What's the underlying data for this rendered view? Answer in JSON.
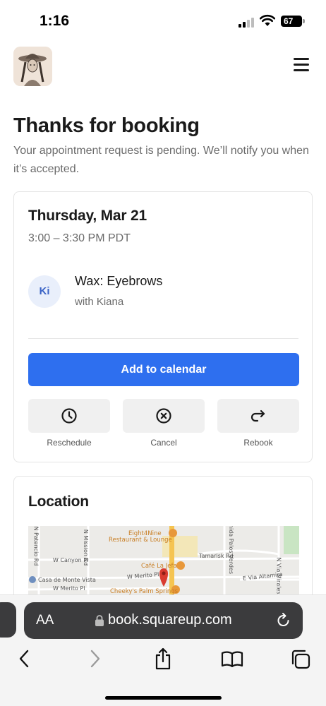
{
  "status_bar": {
    "time": "1:16",
    "battery": "67"
  },
  "header": {
    "logo_alt": "salon logo",
    "menu_icon": "hamburger-menu-icon"
  },
  "page": {
    "title": "Thanks for booking",
    "subtitle": "Your appointment request is pending. We’ll notify you when it’s accepted."
  },
  "appointment": {
    "date": "Thursday, Mar 21",
    "time": "3:00 – 3:30 PM PDT",
    "staff_initials": "Ki",
    "service": "Wax: Eyebrows",
    "staff_line": "with Kiana",
    "add_to_calendar": "Add to calendar",
    "actions": [
      {
        "label": "Reschedule",
        "icon": "clock-icon"
      },
      {
        "label": "Cancel",
        "icon": "circle-x-icon"
      },
      {
        "label": "Rebook",
        "icon": "redo-arrow-icon"
      }
    ]
  },
  "location": {
    "title": "Location",
    "map_labels": {
      "eight4nine": "Eight4Nine",
      "eight4nine_sub": "Restaurant & Lounge",
      "cafe": "Café La Jefa",
      "cheekys": "Cheeky's Palm Springs",
      "casa": "Casa de Monte Vista",
      "w_canyon": "W Canyon Pl",
      "w_merito_1": "W Merito Pl",
      "w_merito_2": "W Merito Pl",
      "tamarisk": "Tamarisk Rd",
      "e_via_altamira": "E Via Altamira",
      "n_patencio": "N Patencio Rd",
      "n_mission": "N Mission Rd",
      "palos_verdes": "enida Palos Verdes",
      "n_via_miraleste": "N Via Miraleste"
    }
  },
  "browser": {
    "text_size_label": "AA",
    "url": "book.squareup.com"
  },
  "colors": {
    "primary": "#2e6fef",
    "avatar_bg": "#e9effb",
    "avatar_text": "#3a63c6",
    "map_pin": "#d93b30"
  }
}
